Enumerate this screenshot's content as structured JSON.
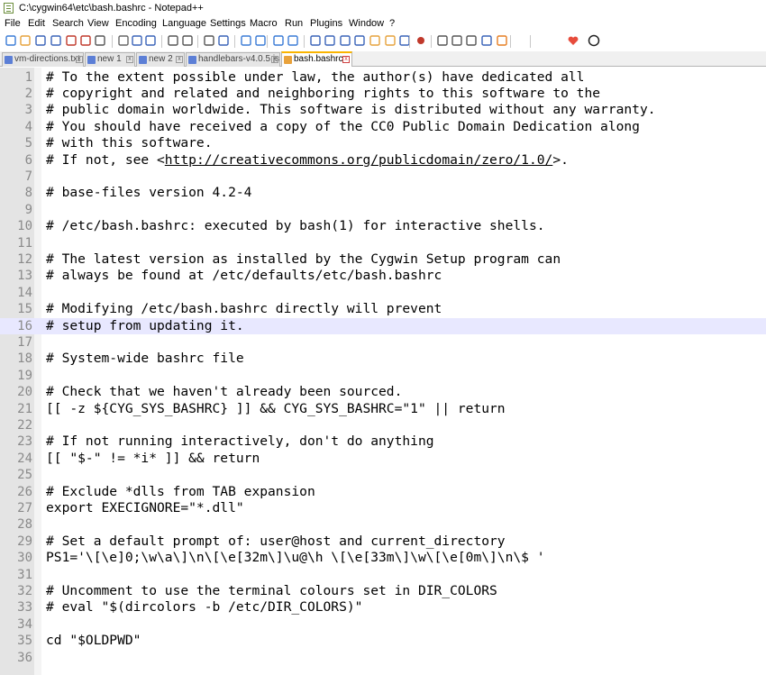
{
  "window": {
    "title": "C:\\cygwin64\\etc\\bash.bashrc - Notepad++"
  },
  "menu": {
    "items": [
      "File",
      "Edit",
      "Search",
      "View",
      "Encoding",
      "Language",
      "Settings",
      "Macro",
      "Run",
      "Plugins",
      "Window",
      "?"
    ]
  },
  "toolbar": {
    "icons": [
      "new-file-icon",
      "open-file-icon",
      "save-icon",
      "save-all-icon",
      "close-icon",
      "close-all-icon",
      "print-icon",
      "cut-icon",
      "copy-icon",
      "paste-icon",
      "undo-icon",
      "redo-icon",
      "find-icon",
      "replace-icon",
      "zoom-in-icon",
      "zoom-out-icon",
      "sync-vertical-icon",
      "sync-horizontal-icon",
      "word-wrap-icon",
      "show-all-characters-icon",
      "indent-guide-icon",
      "document-map-icon",
      "function-list-icon",
      "folder-as-workspace-icon",
      "monitoring-icon",
      "record-macro-icon",
      "stop-recording-icon",
      "play-macro-icon",
      "run-macro-multiple-icon",
      "save-macro-icon",
      "spell-check-icon",
      "heart-icon",
      "circle-icon"
    ]
  },
  "tabs": [
    {
      "label": "vm-directions.txt",
      "active": false
    },
    {
      "label": "new 1",
      "active": false
    },
    {
      "label": "new 2",
      "active": false
    },
    {
      "label": "handlebars-v4.0.5.js",
      "active": false
    },
    {
      "label": "bash.bashrc",
      "active": true
    }
  ],
  "editor": {
    "current_line": 16,
    "lines": [
      {
        "num": "1",
        "text": "# To the extent possible under law, the author(s) have dedicated all"
      },
      {
        "num": "2",
        "text": "# copyright and related and neighboring rights to this software to the"
      },
      {
        "num": "3",
        "text": "# public domain worldwide. This software is distributed without any warranty."
      },
      {
        "num": "4",
        "text": "# You should have received a copy of the CC0 Public Domain Dedication along"
      },
      {
        "num": "5",
        "text": "# with this software."
      },
      {
        "num": "6",
        "text_before": "# If not, see <",
        "url": "http://creativecommons.org/publicdomain/zero/1.0/",
        "text_after": ">."
      },
      {
        "num": "7",
        "text": ""
      },
      {
        "num": "8",
        "text": "# base-files version 4.2-4"
      },
      {
        "num": "9",
        "text": ""
      },
      {
        "num": "10",
        "text": "# /etc/bash.bashrc: executed by bash(1) for interactive shells."
      },
      {
        "num": "11",
        "text": ""
      },
      {
        "num": "12",
        "text": "# The latest version as installed by the Cygwin Setup program can"
      },
      {
        "num": "13",
        "text": "# always be found at /etc/defaults/etc/bash.bashrc"
      },
      {
        "num": "14",
        "text": ""
      },
      {
        "num": "15",
        "text": "# Modifying /etc/bash.bashrc directly will prevent"
      },
      {
        "num": "16",
        "text": "# setup from updating it."
      },
      {
        "num": "17",
        "text": ""
      },
      {
        "num": "18",
        "text": "# System-wide bashrc file"
      },
      {
        "num": "19",
        "text": ""
      },
      {
        "num": "20",
        "text": "# Check that we haven't already been sourced."
      },
      {
        "num": "21",
        "text": "[[ -z ${CYG_SYS_BASHRC} ]] && CYG_SYS_BASHRC=\"1\" || return"
      },
      {
        "num": "22",
        "text": ""
      },
      {
        "num": "23",
        "text": "# If not running interactively, don't do anything"
      },
      {
        "num": "24",
        "text": "[[ \"$-\" != *i* ]] && return"
      },
      {
        "num": "25",
        "text": ""
      },
      {
        "num": "26",
        "text": "# Exclude *dlls from TAB expansion"
      },
      {
        "num": "27",
        "text": "export EXECIGNORE=\"*.dll\""
      },
      {
        "num": "28",
        "text": ""
      },
      {
        "num": "29",
        "text": "# Set a default prompt of: user@host and current_directory"
      },
      {
        "num": "30",
        "text": "PS1='\\[\\e]0;\\w\\a\\]\\n\\[\\e[32m\\]\\u@\\h \\[\\e[33m\\]\\w\\[\\e[0m\\]\\n\\$ '"
      },
      {
        "num": "31",
        "text": ""
      },
      {
        "num": "32",
        "text": "# Uncomment to use the terminal colours set in DIR_COLORS"
      },
      {
        "num": "33",
        "text": "# eval \"$(dircolors -b /etc/DIR_COLORS)\""
      },
      {
        "num": "34",
        "text": ""
      },
      {
        "num": "35",
        "text": "cd \"$OLDPWD\""
      },
      {
        "num": "36",
        "text": ""
      }
    ]
  },
  "colors": {
    "current_line_highlight": "#e8e8ff",
    "gutter": "#e4e4e4",
    "active_tab_accent": "#fab400",
    "line_number": "#8a8a8a"
  }
}
